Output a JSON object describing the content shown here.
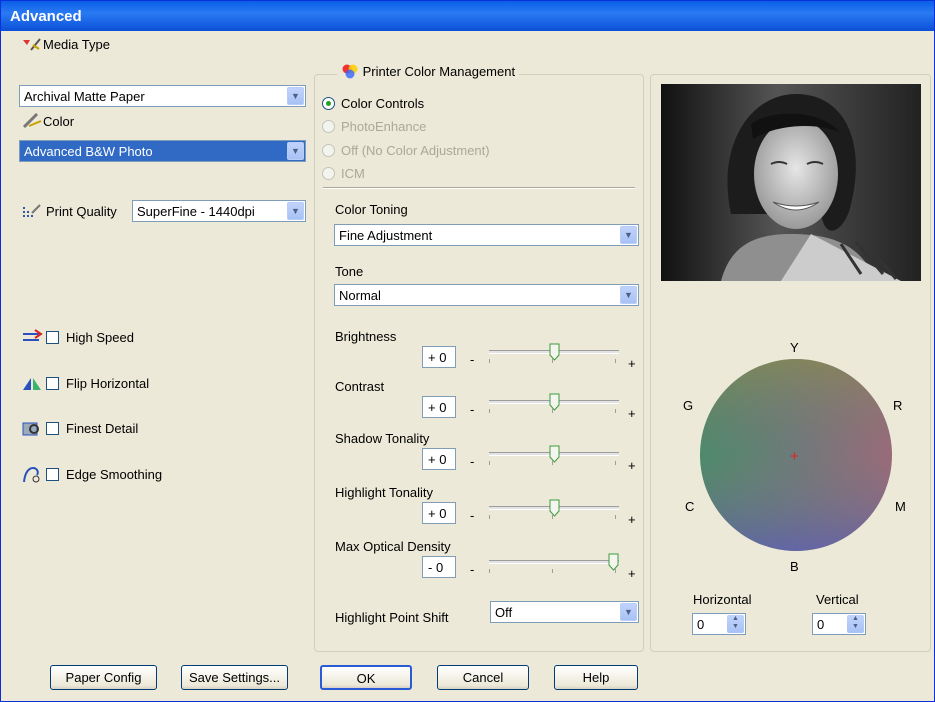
{
  "window": {
    "title": "Advanced"
  },
  "media_type": {
    "label": "Media Type",
    "value": "Archival Matte Paper"
  },
  "color": {
    "label": "Color",
    "value": "Advanced B&W Photo"
  },
  "print_quality": {
    "label": "Print Quality",
    "value": "SuperFine - 1440dpi"
  },
  "options": {
    "high_speed": "High Speed",
    "flip_horizontal": "Flip Horizontal",
    "finest_detail": "Finest Detail",
    "edge_smoothing": "Edge Smoothing"
  },
  "color_management": {
    "title": "Printer Color Management",
    "options": [
      "Color Controls",
      "PhotoEnhance",
      "Off (No Color Adjustment)",
      "ICM"
    ],
    "selected": "Color Controls"
  },
  "color_toning": {
    "label": "Color Toning",
    "value": "Fine Adjustment"
  },
  "tone": {
    "label": "Tone",
    "value": "Normal"
  },
  "sliders": [
    {
      "label": "Brightness",
      "value": "+ 0",
      "level": 0.5
    },
    {
      "label": "Contrast",
      "value": "+ 0",
      "level": 0.5
    },
    {
      "label": "Shadow Tonality",
      "value": "+ 0",
      "level": 0.5
    },
    {
      "label": "Highlight Tonality",
      "value": "+ 0",
      "level": 0.5
    },
    {
      "label": "Max Optical Density",
      "value": "- 0",
      "level": 1.0
    }
  ],
  "slider_signs": {
    "minus": "-",
    "plus": "+"
  },
  "highlight_point_shift": {
    "label": "Highlight Point Shift",
    "value": "Off"
  },
  "color_wheel": {
    "top": "Y",
    "left_top": "G",
    "right_top": "R",
    "left_bottom": "C",
    "right_bottom": "M",
    "bottom": "B",
    "marker": "+"
  },
  "horizontal": {
    "label": "Horizontal",
    "value": "0"
  },
  "vertical": {
    "label": "Vertical",
    "value": "0"
  },
  "buttons": {
    "paper_config": "Paper Config",
    "save_settings": "Save Settings...",
    "ok": "OK",
    "cancel": "Cancel",
    "help": "Help"
  },
  "colors": {
    "title_bar": "#0a5fe6",
    "dialog_bg": "#ece9d8",
    "selection": "#316ac5",
    "radio_dot": "#21a121"
  }
}
